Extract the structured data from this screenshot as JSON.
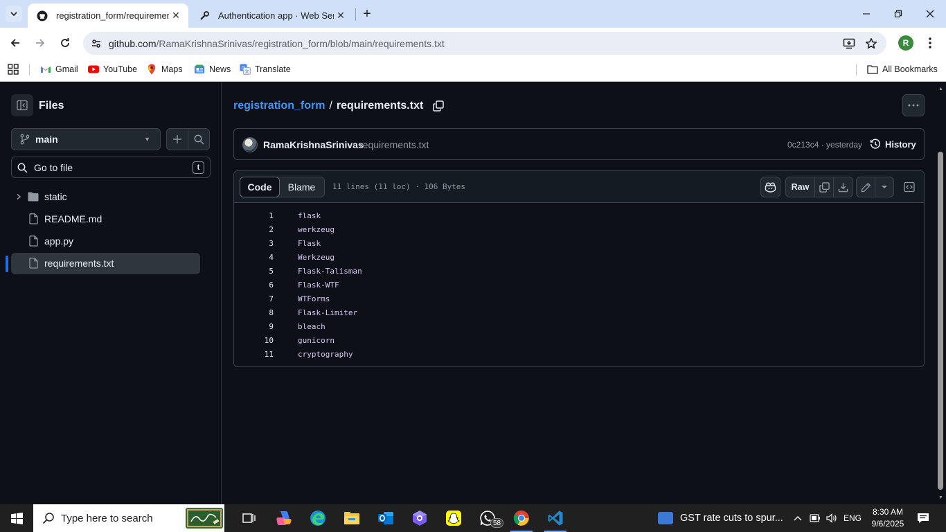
{
  "browser": {
    "tabs": [
      {
        "title": "registration_form/requirements",
        "active": true
      },
      {
        "title": "Authentication app · Web Servi",
        "active": false
      }
    ],
    "address": {
      "host": "github.com",
      "path": "/RamaKrishnaSrinivas/registration_form/blob/main/requirements.txt"
    },
    "profile_initial": "R",
    "bookmarks": [
      {
        "label": "Gmail",
        "icon": "gmail-icon"
      },
      {
        "label": "YouTube",
        "icon": "youtube-icon"
      },
      {
        "label": "Maps",
        "icon": "maps-icon"
      },
      {
        "label": "News",
        "icon": "news-icon"
      },
      {
        "label": "Translate",
        "icon": "translate-icon"
      }
    ],
    "all_bookmarks": "All Bookmarks"
  },
  "sidebar": {
    "title": "Files",
    "branch": "main",
    "goto_placeholder": "Go to file",
    "goto_shortcut": "t",
    "tree": [
      {
        "label": "static",
        "type": "folder"
      },
      {
        "label": "README.md",
        "type": "file"
      },
      {
        "label": "app.py",
        "type": "file"
      },
      {
        "label": "requirements.txt",
        "type": "file",
        "selected": true
      }
    ]
  },
  "breadcrumb": {
    "repo": "registration_form",
    "separator": "/",
    "file": "requirements.txt"
  },
  "commit": {
    "author": "RamaKrishnaSrinivas",
    "message": "requirements.txt",
    "sha_time": "0c213c4 · yesterday",
    "history_label": "History"
  },
  "code": {
    "tabs": {
      "code": "Code",
      "blame": "Blame"
    },
    "info": "11 lines (11 loc) · 106 Bytes",
    "raw_label": "Raw",
    "lines": [
      {
        "n": "1",
        "text": "flask"
      },
      {
        "n": "2",
        "text": "werkzeug"
      },
      {
        "n": "3",
        "text": "Flask"
      },
      {
        "n": "4",
        "text": "Werkzeug"
      },
      {
        "n": "5",
        "text": "Flask-Talisman"
      },
      {
        "n": "6",
        "text": "Flask-WTF"
      },
      {
        "n": "7",
        "text": "WTForms"
      },
      {
        "n": "8",
        "text": "Flask-Limiter"
      },
      {
        "n": "9",
        "text": "bleach"
      },
      {
        "n": "10",
        "text": "gunicorn"
      },
      {
        "n": "11",
        "text": "cryptography"
      }
    ]
  },
  "taskbar": {
    "search_placeholder": "Type here to search",
    "whatsapp_badge": "58",
    "news_text": "GST rate cuts to spur...",
    "language": "ENG",
    "time": "8:30 AM",
    "date": "9/6/2025"
  },
  "colors": {
    "accent_link": "#4493f8",
    "code_text": "#d7c6f5",
    "selection": "#1f6feb"
  }
}
